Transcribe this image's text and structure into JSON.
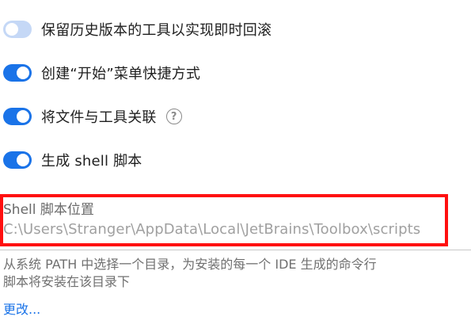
{
  "toggles": [
    {
      "label": "保留历史版本的工具以实现即时回滚",
      "state": "off"
    },
    {
      "label": "创建“开始”菜单快捷方式",
      "state": "on"
    },
    {
      "label": "将文件与工具关联",
      "state": "on",
      "help_icon": "question-circle-icon"
    },
    {
      "label": "生成 shell 脚本",
      "state": "on"
    }
  ],
  "help_glyph": "?",
  "shell_location": {
    "label": "Shell 脚本位置",
    "value": "C:\\Users\\Stranger\\AppData\\Local\\JetBrains\\Toolbox\\scripts"
  },
  "description": {
    "line1": "从系统 PATH 中选择一个目录，为安装的每一个 IDE 生成的命令行",
    "line2": "脚本将安装在该目录下"
  },
  "change_link": "更改...",
  "colors": {
    "accent": "#1a73e8",
    "toggle_off": "#c5d8f6",
    "highlight_box": "#ff0f0f"
  }
}
